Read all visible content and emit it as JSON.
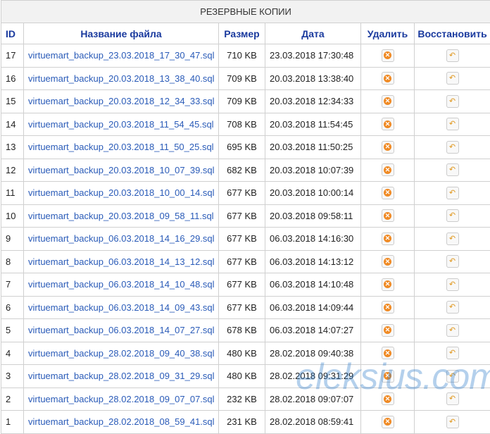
{
  "title": "РЕЗЕРВНЫЕ КОПИИ",
  "columns": {
    "id": "ID",
    "name": "Название файла",
    "size": "Размер",
    "date": "Дата",
    "delete": "Удалить",
    "restore": "Восстановить"
  },
  "rows": [
    {
      "id": "17",
      "name": "virtuemart_backup_23.03.2018_17_30_47.sql",
      "size": "710 KB",
      "date": "23.03.2018 17:30:48"
    },
    {
      "id": "16",
      "name": "virtuemart_backup_20.03.2018_13_38_40.sql",
      "size": "709 KB",
      "date": "20.03.2018 13:38:40"
    },
    {
      "id": "15",
      "name": "virtuemart_backup_20.03.2018_12_34_33.sql",
      "size": "709 KB",
      "date": "20.03.2018 12:34:33"
    },
    {
      "id": "14",
      "name": "virtuemart_backup_20.03.2018_11_54_45.sql",
      "size": "708 KB",
      "date": "20.03.2018 11:54:45"
    },
    {
      "id": "13",
      "name": "virtuemart_backup_20.03.2018_11_50_25.sql",
      "size": "695 KB",
      "date": "20.03.2018 11:50:25"
    },
    {
      "id": "12",
      "name": "virtuemart_backup_20.03.2018_10_07_39.sql",
      "size": "682 KB",
      "date": "20.03.2018 10:07:39"
    },
    {
      "id": "11",
      "name": "virtuemart_backup_20.03.2018_10_00_14.sql",
      "size": "677 KB",
      "date": "20.03.2018 10:00:14"
    },
    {
      "id": "10",
      "name": "virtuemart_backup_20.03.2018_09_58_11.sql",
      "size": "677 KB",
      "date": "20.03.2018 09:58:11"
    },
    {
      "id": "9",
      "name": "virtuemart_backup_06.03.2018_14_16_29.sql",
      "size": "677 KB",
      "date": "06.03.2018 14:16:30"
    },
    {
      "id": "8",
      "name": "virtuemart_backup_06.03.2018_14_13_12.sql",
      "size": "677 KB",
      "date": "06.03.2018 14:13:12"
    },
    {
      "id": "7",
      "name": "virtuemart_backup_06.03.2018_14_10_48.sql",
      "size": "677 KB",
      "date": "06.03.2018 14:10:48"
    },
    {
      "id": "6",
      "name": "virtuemart_backup_06.03.2018_14_09_43.sql",
      "size": "677 KB",
      "date": "06.03.2018 14:09:44"
    },
    {
      "id": "5",
      "name": "virtuemart_backup_06.03.2018_14_07_27.sql",
      "size": "678 KB",
      "date": "06.03.2018 14:07:27"
    },
    {
      "id": "4",
      "name": "virtuemart_backup_28.02.2018_09_40_38.sql",
      "size": "480 KB",
      "date": "28.02.2018 09:40:38"
    },
    {
      "id": "3",
      "name": "virtuemart_backup_28.02.2018_09_31_29.sql",
      "size": "480 KB",
      "date": "28.02.2018 09:31:29"
    },
    {
      "id": "2",
      "name": "virtuemart_backup_28.02.2018_09_07_07.sql",
      "size": "232 KB",
      "date": "28.02.2018 09:07:07"
    },
    {
      "id": "1",
      "name": "virtuemart_backup_28.02.2018_08_59_41.sql",
      "size": "231 KB",
      "date": "28.02.2018 08:59:41"
    }
  ],
  "icons": {
    "delete": "delete-icon",
    "restore": "restore-icon"
  },
  "colors": {
    "link": "#2a5bb8",
    "header": "#1a3a9e",
    "delete_accent": "#f08a24",
    "restore_accent": "#e09820"
  },
  "watermark": "eleksius.com"
}
